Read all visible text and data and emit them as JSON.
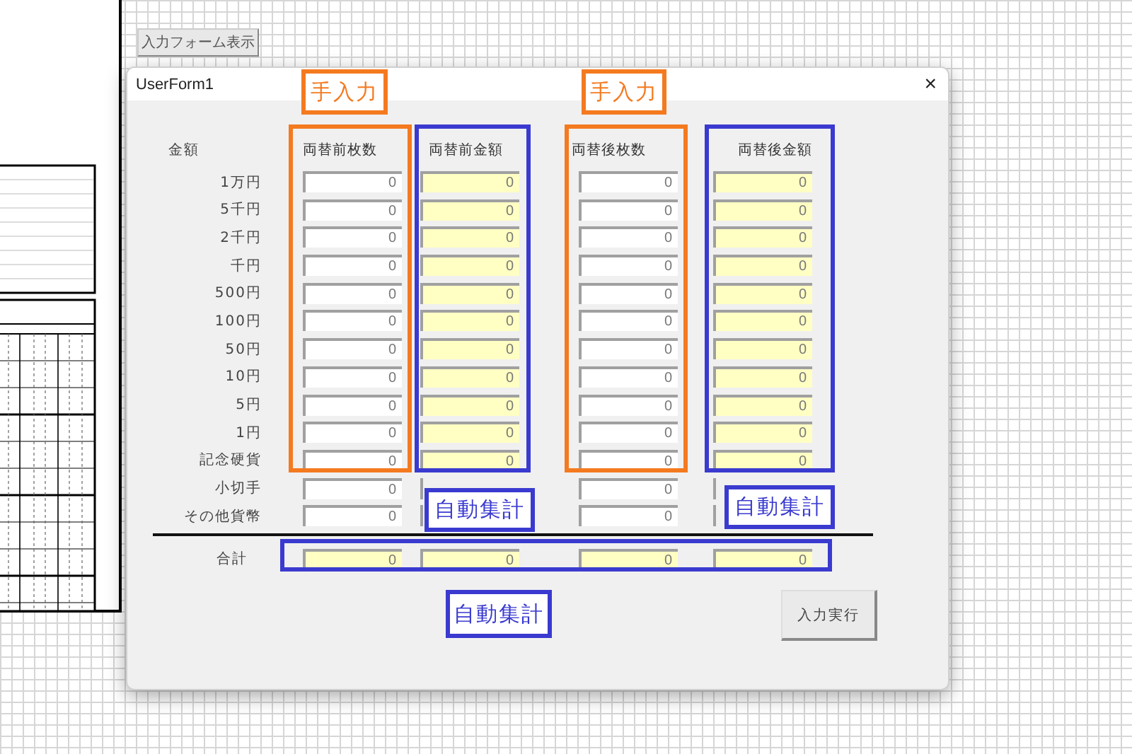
{
  "sheet": {
    "button": "入力フォーム表示"
  },
  "dialog": {
    "title": "UserForm1",
    "close": "×",
    "amount_header": "金額",
    "columns": [
      {
        "label": "両替前枚数",
        "kind": "manual"
      },
      {
        "label": "両替前金額",
        "kind": "auto"
      },
      {
        "label": "両替後枚数",
        "kind": "manual"
      },
      {
        "label": "両替後金額",
        "kind": "auto"
      }
    ],
    "rows": [
      {
        "label": "1万円",
        "values": [
          "0",
          "0",
          "0",
          "0"
        ]
      },
      {
        "label": "5千円",
        "values": [
          "0",
          "0",
          "0",
          "0"
        ]
      },
      {
        "label": "2千円",
        "values": [
          "0",
          "0",
          "0",
          "0"
        ]
      },
      {
        "label": "千円",
        "values": [
          "0",
          "0",
          "0",
          "0"
        ]
      },
      {
        "label": "500円",
        "values": [
          "0",
          "0",
          "0",
          "0"
        ]
      },
      {
        "label": "100円",
        "values": [
          "0",
          "0",
          "0",
          "0"
        ]
      },
      {
        "label": "50円",
        "values": [
          "0",
          "0",
          "0",
          "0"
        ]
      },
      {
        "label": "10円",
        "values": [
          "0",
          "0",
          "0",
          "0"
        ]
      },
      {
        "label": "5円",
        "values": [
          "0",
          "0",
          "0",
          "0"
        ]
      },
      {
        "label": "1円",
        "values": [
          "0",
          "0",
          "0",
          "0"
        ]
      },
      {
        "label": "記念硬貨",
        "values": [
          "0",
          "0",
          "0",
          "0"
        ]
      },
      {
        "label": "小切手",
        "kind": "partial",
        "values": [
          "0",
          "0"
        ]
      },
      {
        "label": "その他貨幣",
        "kind": "partial",
        "values": [
          "0",
          "0"
        ]
      }
    ],
    "total": {
      "label": "合計",
      "values": [
        "0",
        "0",
        "0",
        "0"
      ]
    },
    "submit_button": "入力実行"
  },
  "annotations": {
    "frames": [
      {
        "kind": "manual"
      },
      {
        "kind": "auto"
      },
      {
        "kind": "manual"
      },
      {
        "kind": "auto"
      },
      {
        "kind": "auto"
      }
    ],
    "labels": [
      {
        "text": "手入力",
        "kind": "manual"
      },
      {
        "text": "手入力",
        "kind": "manual"
      },
      {
        "text": "自動集計",
        "kind": "auto"
      },
      {
        "text": "自動集計",
        "kind": "auto"
      },
      {
        "text": "自動集計",
        "kind": "auto"
      }
    ]
  }
}
